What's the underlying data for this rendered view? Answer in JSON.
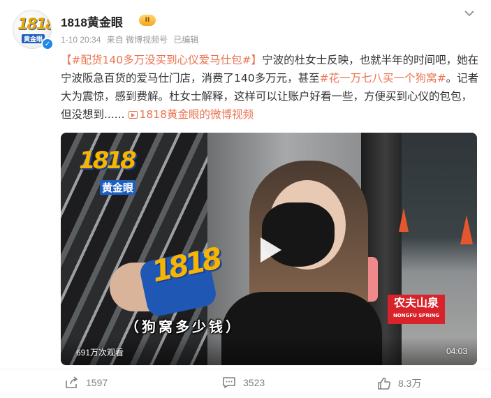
{
  "post": {
    "author": {
      "name": "1818黄金眼",
      "vip_level": "II",
      "avatar_text": "1818",
      "avatar_subtext": "黄金眼"
    },
    "meta": {
      "date": "1-10 20:34",
      "source": "来自 微博视频号",
      "edited": "已编辑"
    },
    "content": {
      "hashtag1": "【#配货140多万没买到心仪爱马仕包#】",
      "text1": "宁波的杜女士反映，也就半年的时间吧，她在宁波阪急百货的爱马仕门店，消费了140多万元，甚至",
      "hashtag2": "#花一万七八买一个狗窝#",
      "text2": "。记者大为震惊，感到费解。杜女士解释，这样可以让账户好看一些，方便买到心仪的包包，但没想到......",
      "video_link": "1818黄金眼的微博视频"
    },
    "video": {
      "corner_logo_num": "1818",
      "corner_logo_sub": "黄金眼",
      "mic_logo": "1818",
      "caption": "（狗窝多少钱）",
      "sponsor_cn": "农夫山泉",
      "sponsor_en": "NONGFU SPRING",
      "views": "691万次观看",
      "duration": "04:03"
    },
    "actions": {
      "share_count": "1597",
      "comment_count": "3523",
      "like_count": "8.3万"
    }
  }
}
